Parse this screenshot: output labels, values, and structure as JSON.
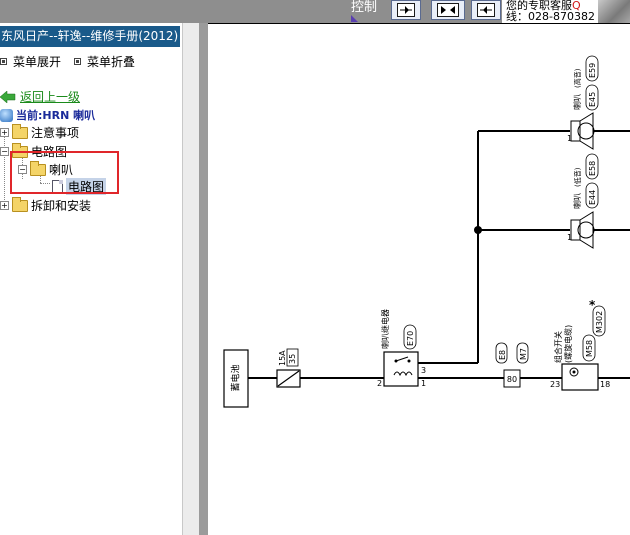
{
  "toolbar": {
    "control_label": "控制",
    "contact_line1": "您的专职客服",
    "contact_line1_red": "Q",
    "contact_line2": "线：028-870382"
  },
  "sidebar": {
    "title": "东风日产--轩逸--维修手册(2012)",
    "expand_label": "菜单展开",
    "collapse_label": "菜单折叠",
    "back_label": "返回上一级",
    "current_label": "当前:HRN 喇叭",
    "tree": {
      "item_notes": "注意事项",
      "item_circuit": "电路图",
      "item_horn": "喇叭",
      "item_horn_circuit": "电路图",
      "item_disassembly": "拆卸和安装"
    }
  },
  "diagram": {
    "battery": "蓄电池",
    "fuse_rating": "15A",
    "fuse_number": "35",
    "relay_label": "喇叭继电器",
    "relay_connector": "E70",
    "relay_pin_3": "3",
    "relay_pin_2": "2",
    "relay_pin_1": "1",
    "connector_e8": "E8",
    "connector_m7": "M7",
    "connector_pin_80": "80",
    "combo_switch_label": "组合开关",
    "combo_switch_sub": "(螺旋电缆)",
    "combo_connector_m58": "M58",
    "combo_connector_m302": "M302",
    "combo_pin_23": "23",
    "combo_pin_18": "18",
    "horn_high_label": "喇叭",
    "horn_high_sub": "(高音)",
    "horn_high_c1": "E45",
    "horn_high_c2": "E59",
    "horn_high_pin": "1",
    "horn_low_label": "喇叭",
    "horn_low_sub": "(低音)",
    "horn_low_c1": "E44",
    "horn_low_c2": "E58",
    "horn_low_pin": "1",
    "star": "*"
  }
}
